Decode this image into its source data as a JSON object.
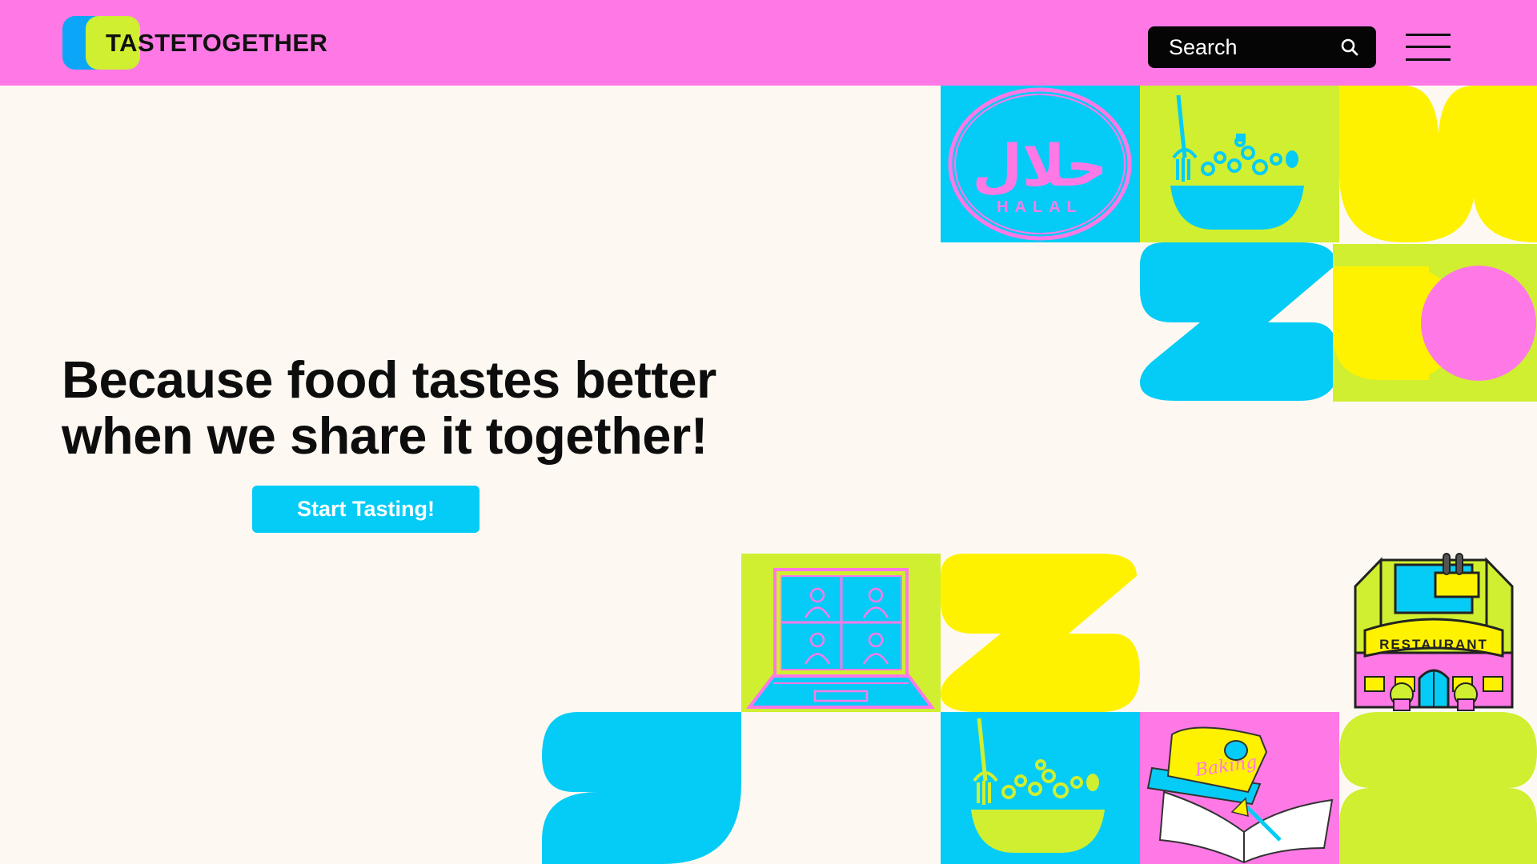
{
  "header": {
    "brand": "TASTETOGETHER",
    "search_placeholder": "Search"
  },
  "hero": {
    "headline": "Because food tastes better\nwhen we share it together!",
    "cta_label": "Start Tasting!"
  },
  "tiles": {
    "halal_arabic": "حلال",
    "halal_label": "HALAL",
    "restaurant_label": "RESTAURANT",
    "book_label": "Baking"
  },
  "colors": {
    "header_bg": "#ff79e6",
    "page_bg": "#fdf9f2",
    "cyan": "#05ccf6",
    "lime": "#cfef30",
    "yellow": "#fff200",
    "pink": "#ff79e6"
  }
}
